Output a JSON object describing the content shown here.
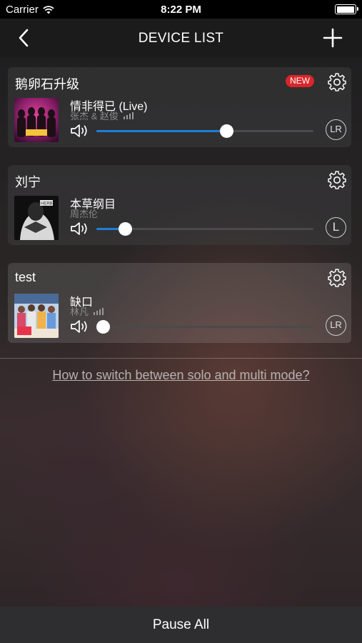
{
  "status_bar": {
    "carrier": "Carrier",
    "time": "8:22 PM"
  },
  "nav": {
    "title": "DEVICE LIST",
    "back_icon": "chevron-left-icon",
    "add_icon": "plus-icon"
  },
  "devices": [
    {
      "name": "鹅卵石升级",
      "badge": "NEW",
      "song": "情非得已 (Live)",
      "artist": "张杰 & 赵俊",
      "volume_fraction": 0.6,
      "volume_color": "#1e7fd8",
      "channel": "LR",
      "signal_icon": true
    },
    {
      "name": "刘宁",
      "song": "本草纲目",
      "artist": "周杰伦",
      "volume_fraction": 0.13,
      "volume_color": "#1e7fd8",
      "channel": "L",
      "signal_icon": false
    },
    {
      "name": "test",
      "song": "缺口",
      "artist": "林凡",
      "volume_fraction": 0.03,
      "volume_color": "#1e7fd8",
      "channel": "LR",
      "signal_icon": true
    }
  ],
  "help_link": "How to switch between solo and multi mode?",
  "bottom": {
    "pause_all": "Pause All"
  }
}
